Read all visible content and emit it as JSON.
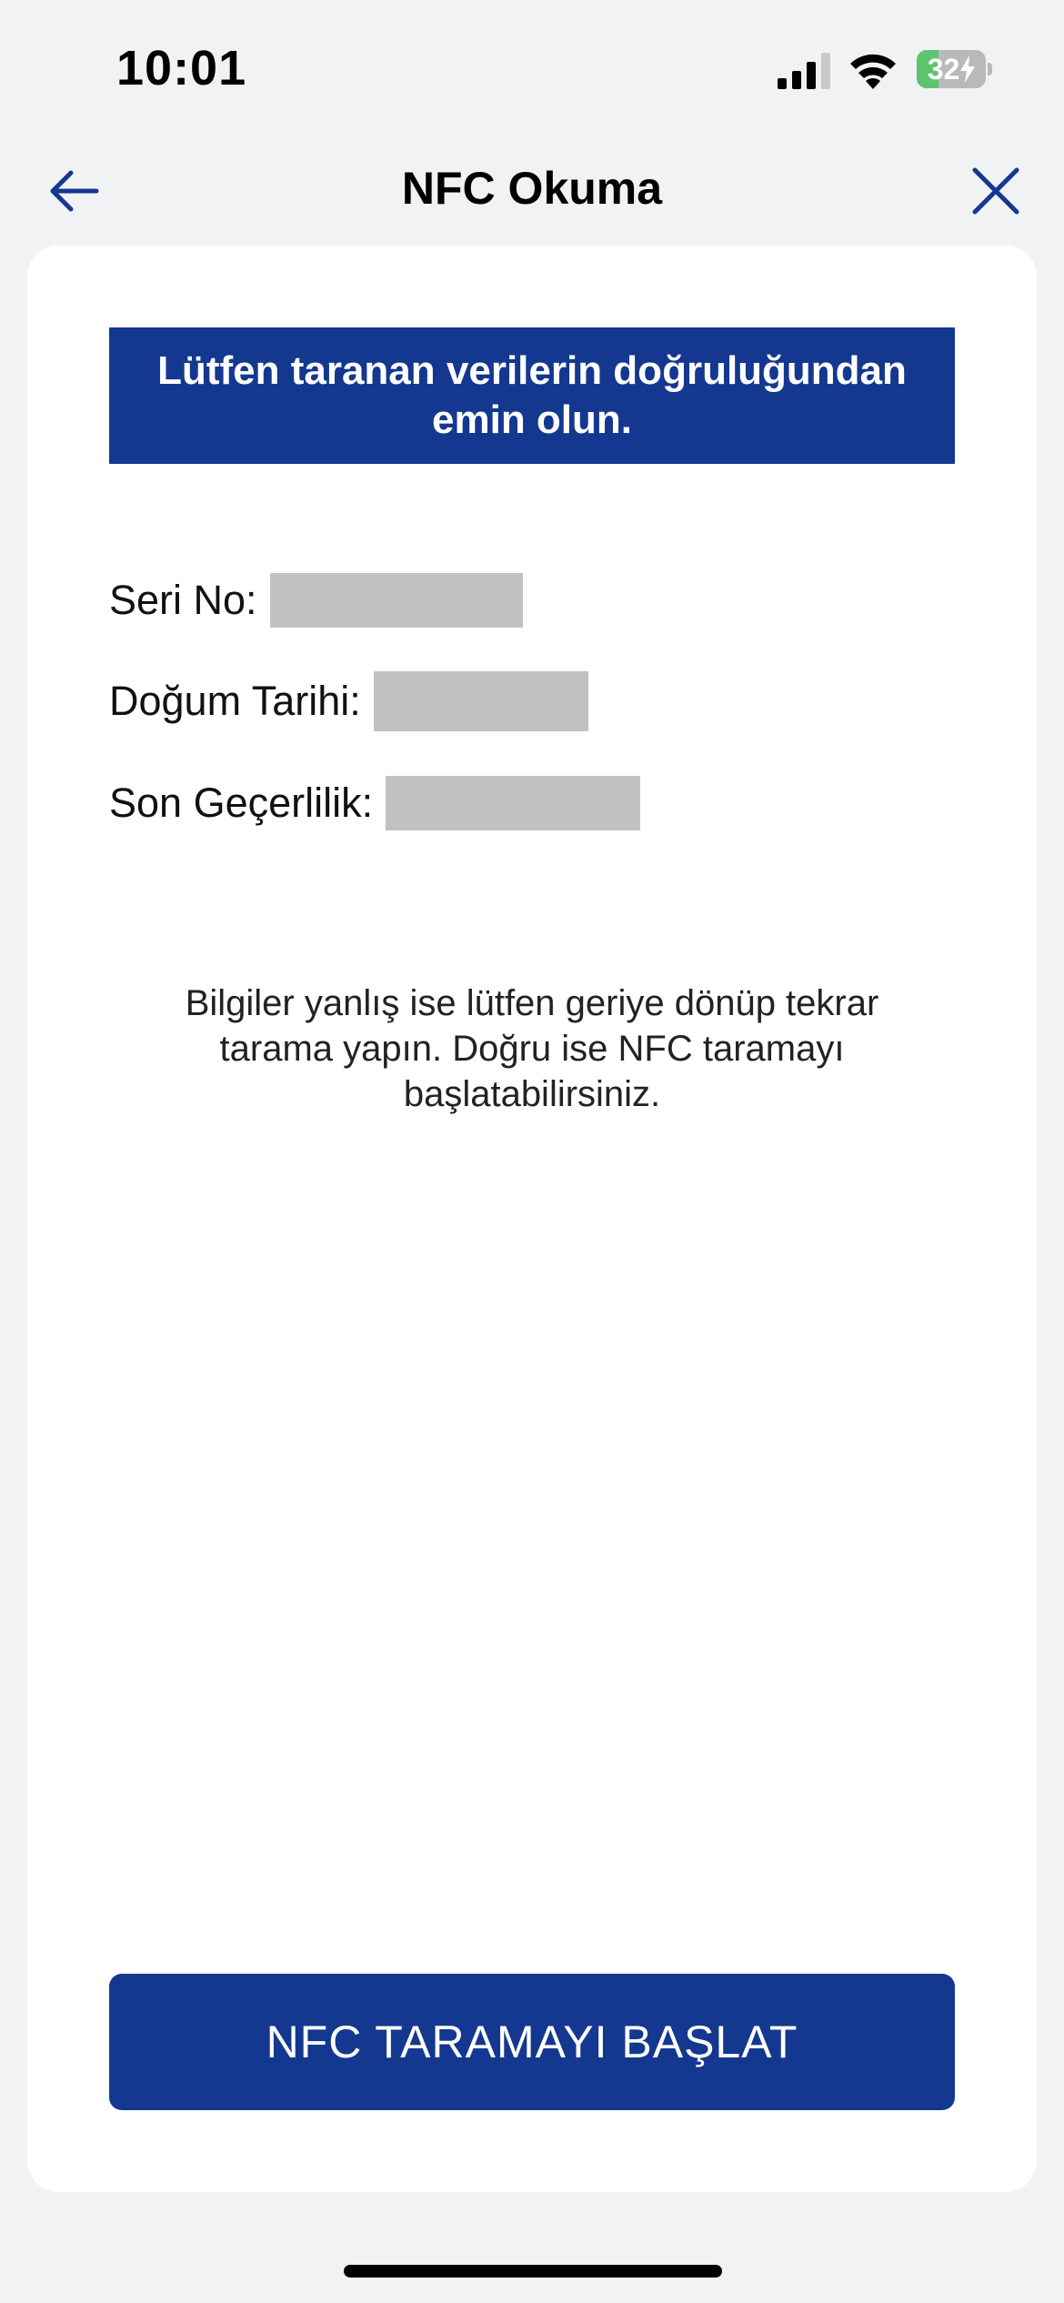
{
  "status_bar": {
    "time": "10:01",
    "battery_level": "32",
    "battery_charging": true,
    "icons": [
      "cellular-signal-icon",
      "wifi-icon",
      "battery-charging-icon"
    ]
  },
  "nav": {
    "title": "NFC Okuma",
    "back_icon": "arrow-left-icon",
    "close_icon": "close-icon",
    "accent_color": "#143890"
  },
  "banner": {
    "text": "Lütfen taranan verilerin doğruluğundan emin olun."
  },
  "fields": [
    {
      "label": "Seri No:"
    },
    {
      "label": "Doğum Tarihi:"
    },
    {
      "label": "Son Geçerlilik:"
    }
  ],
  "hint": {
    "text": "Bilgiler yanlış ise lütfen geriye dönüp tekrar tarama yapın. Doğru ise NFC taramayı başlatabilirsiniz."
  },
  "cta": {
    "label": "NFC TARAMAYI BAŞLAT"
  },
  "colors": {
    "background": "#f1f2f4",
    "card": "#ffffff",
    "primary": "#143890",
    "redaction": "#c1c1c1",
    "battery_green": "#5cc46d"
  }
}
